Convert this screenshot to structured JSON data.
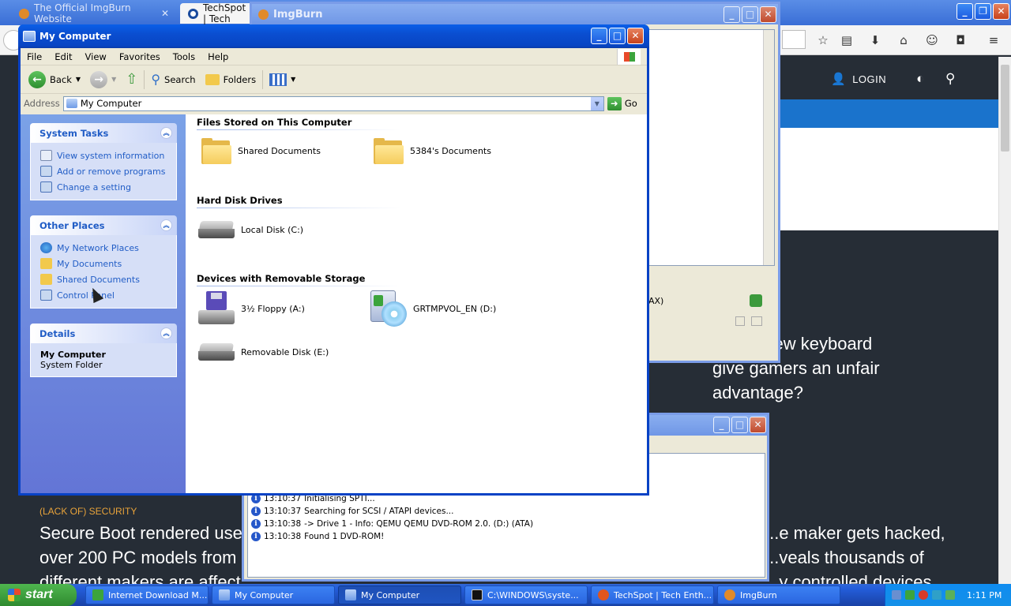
{
  "browser": {
    "tabs": [
      {
        "label": "The Official ImgBurn Website",
        "active": false
      },
      {
        "label": "TechSpot | Tech",
        "active": true
      },
      {
        "label": "ImgBurn",
        "active": false
      }
    ],
    "nav": {
      "login": "LOGIN"
    },
    "headlines": {
      "right_top": [
        "...ter's new keyboard",
        "give gamers an unfair",
        "advantage?"
      ],
      "left_kicker": "(LACK OF) SECURITY",
      "left": [
        "Secure Boot rendered usele...",
        "over 200 PC models from",
        "different makers are affect..."
      ],
      "right_bottom": [
        "...e maker gets hacked,",
        "...veals thousands of",
        "...y controlled devices"
      ]
    }
  },
  "imgburn": {
    "title": "ImgBurn",
    "status_text": "AX)"
  },
  "imgburn_log": {
    "lines": [
      {
        "time": "13:10:37",
        "text": "Initialising SPTI..."
      },
      {
        "time": "13:10:37",
        "text": "Searching for SCSI / ATAPI devices..."
      },
      {
        "time": "13:10:38",
        "text": "-> Drive 1 - Info: QEMU QEMU DVD-ROM 2.0. (D:) (ATA)"
      },
      {
        "time": "13:10:38",
        "text": "Found 1 DVD-ROM!"
      }
    ]
  },
  "window": {
    "title": "My Computer",
    "menu": [
      "File",
      "Edit",
      "View",
      "Favorites",
      "Tools",
      "Help"
    ],
    "toolbar": {
      "back": "Back",
      "search": "Search",
      "folders": "Folders"
    },
    "address": {
      "label": "Address",
      "value": "My Computer",
      "go": "Go"
    },
    "tasks": {
      "system": {
        "title": "System Tasks",
        "items": [
          "View system information",
          "Add or remove programs",
          "Change a setting"
        ]
      },
      "other": {
        "title": "Other Places",
        "items": [
          "My Network Places",
          "My Documents",
          "Shared Documents",
          "Control Panel"
        ]
      },
      "details": {
        "title": "Details",
        "name": "My Computer",
        "type": "System Folder"
      }
    },
    "groups": {
      "files": {
        "title": "Files Stored on This Computer",
        "items": [
          "Shared Documents",
          "5384's Documents"
        ]
      },
      "hdd": {
        "title": "Hard Disk Drives",
        "items": [
          "Local Disk (C:)"
        ]
      },
      "removable": {
        "title": "Devices with Removable Storage",
        "items": [
          "3½ Floppy (A:)",
          "GRTMPVOL_EN (D:)",
          "Removable Disk (E:)"
        ]
      }
    }
  },
  "taskbar": {
    "start": "start",
    "buttons": [
      {
        "label": "Internet Download M...",
        "active": false
      },
      {
        "label": "My Computer",
        "active": false
      },
      {
        "label": "My Computer",
        "active": true
      },
      {
        "label": "C:\\WINDOWS\\syste...",
        "active": false
      },
      {
        "label": "TechSpot | Tech Enth...",
        "active": false
      },
      {
        "label": "ImgBurn",
        "active": false
      }
    ],
    "clock": "1:11 PM"
  },
  "colors": {
    "xp_blue": "#0842c5",
    "techspot_blue": "#1a73cc",
    "task_link": "#215dc6"
  }
}
